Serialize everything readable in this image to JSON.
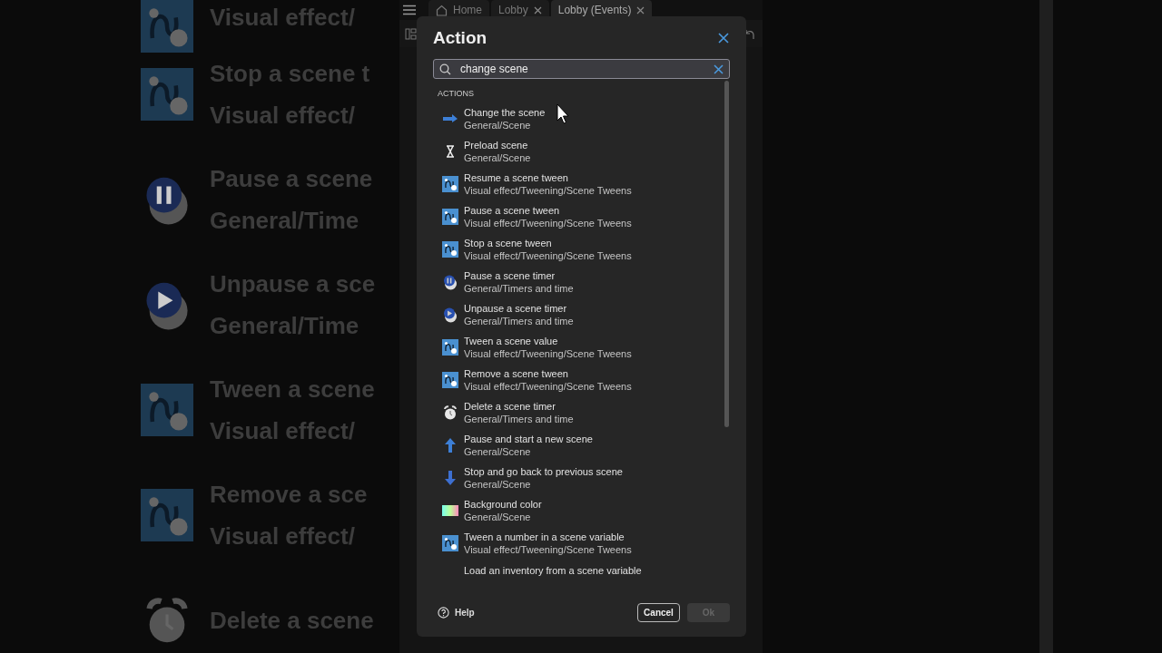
{
  "backdrop_left": {
    "items": [
      {
        "kind": "tween",
        "subtitle": "Visual effect/"
      },
      {
        "kind": "tween",
        "title": "Stop a scene t",
        "subtitle": "Visual effect/"
      },
      {
        "kind": "timer-pause",
        "title": "Pause a scene",
        "subtitle": "General/Time"
      },
      {
        "kind": "timer-play",
        "title": "Unpause a sce",
        "subtitle": "General/Time"
      },
      {
        "kind": "tween",
        "title": "Tween a scene",
        "subtitle": "Visual effect/"
      },
      {
        "kind": "tween",
        "title": "Remove a sce",
        "subtitle": "Visual effect/"
      },
      {
        "kind": "alarm",
        "title": "Delete a scene"
      }
    ]
  },
  "tabs": [
    {
      "label": "Home",
      "kind": "home",
      "selected": false
    },
    {
      "label": "Lobby",
      "kind": "closable",
      "selected": false
    },
    {
      "label": "Lobby (Events)",
      "kind": "closable",
      "selected": true
    }
  ],
  "dialog": {
    "title": "Action",
    "search": {
      "value": "change scene"
    },
    "section": "ACTIONS",
    "items": [
      {
        "kind": "arrow-right",
        "title": "Change the scene",
        "subtitle": "General/Scene"
      },
      {
        "kind": "hourglass",
        "title": "Preload scene",
        "subtitle": "General/Scene"
      },
      {
        "kind": "tween",
        "title": "Resume a scene tween",
        "subtitle": "Visual effect/Tweening/Scene Tweens"
      },
      {
        "kind": "tween",
        "title": "Pause a scene tween",
        "subtitle": "Visual effect/Tweening/Scene Tweens"
      },
      {
        "kind": "tween",
        "title": "Stop a scene tween",
        "subtitle": "Visual effect/Tweening/Scene Tweens"
      },
      {
        "kind": "timer-pause",
        "title": "Pause a scene timer",
        "subtitle": "General/Timers and time"
      },
      {
        "kind": "timer-play",
        "title": "Unpause a scene timer",
        "subtitle": "General/Timers and time"
      },
      {
        "kind": "tween",
        "title": "Tween a scene value",
        "subtitle": "Visual effect/Tweening/Scene Tweens"
      },
      {
        "kind": "tween",
        "title": "Remove a scene tween",
        "subtitle": "Visual effect/Tweening/Scene Tweens"
      },
      {
        "kind": "alarm",
        "title": "Delete a scene timer",
        "subtitle": "General/Timers and time"
      },
      {
        "kind": "arrow-up",
        "title": "Pause and start a new scene",
        "subtitle": "General/Scene"
      },
      {
        "kind": "arrow-down",
        "title": "Stop and go back to previous scene",
        "subtitle": "General/Scene"
      },
      {
        "kind": "gradient",
        "title": "Background color",
        "subtitle": "General/Scene"
      },
      {
        "kind": "tween",
        "title": "Tween a number in a scene variable",
        "subtitle": "Visual effect/Tweening/Scene Tweens"
      },
      {
        "title": "Load an inventory from a scene variable"
      }
    ],
    "help": "Help",
    "cancel": "Cancel",
    "ok": {
      "label": "Ok",
      "disabled": true
    }
  }
}
